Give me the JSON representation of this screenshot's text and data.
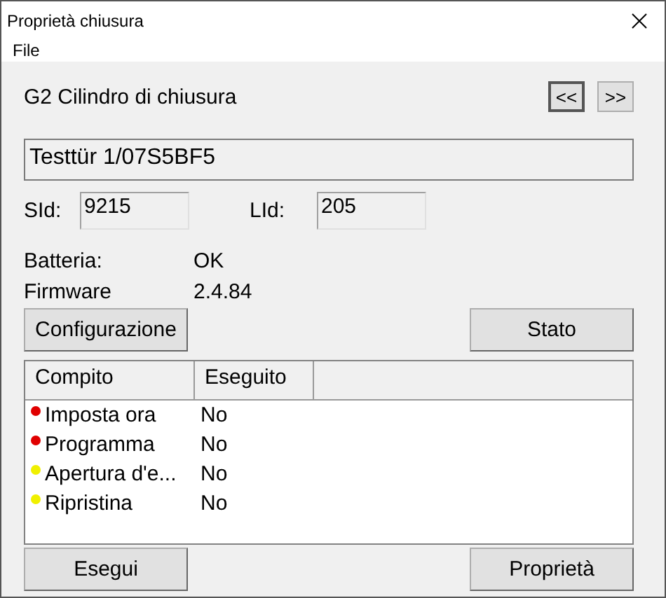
{
  "window": {
    "title": "Proprietà chiusura"
  },
  "menu": [
    "File"
  ],
  "heading": "G2 Cilindro di chiusura",
  "nav_buttons": [
    "<<",
    ">>"
  ],
  "name_field": {
    "value": "Testtür 1/07S5BF5"
  },
  "ids": [
    {
      "label": "SId:",
      "value": "9215"
    },
    {
      "label": "LId:",
      "value": "205"
    }
  ],
  "info": [
    {
      "label": "Batteria:",
      "value": "OK"
    },
    {
      "label": "Firmware",
      "value": "2.4.84"
    }
  ],
  "top_buttons": [
    "Configurazione",
    "Stato"
  ],
  "table": {
    "columns": [
      "Compito",
      "Eseguito"
    ],
    "rows": [
      {
        "task": "Imposta ora",
        "done": "No",
        "color": "#e00000"
      },
      {
        "task": "Programma",
        "done": "No",
        "color": "#e00000"
      },
      {
        "task": "Apertura d'e...",
        "done": "No",
        "color": "#f0f000"
      },
      {
        "task": "Ripristina",
        "done": "No",
        "color": "#f0f000"
      }
    ]
  },
  "bottom_buttons": [
    "Esegui",
    "Proprietà"
  ]
}
